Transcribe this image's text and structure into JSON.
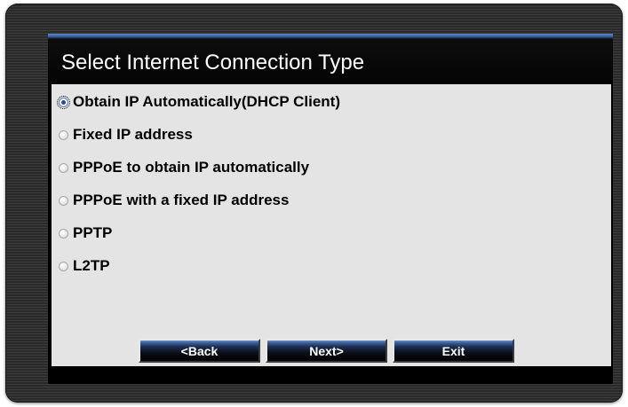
{
  "dialog": {
    "title": "Select Internet Connection Type"
  },
  "options": [
    {
      "label": "Obtain IP Automatically(DHCP Client)",
      "selected": true
    },
    {
      "label": "Fixed IP address",
      "selected": false
    },
    {
      "label": "PPPoE to obtain IP automatically",
      "selected": false
    },
    {
      "label": "PPPoE with a fixed IP address",
      "selected": false
    },
    {
      "label": "PPTP",
      "selected": false
    },
    {
      "label": "L2TP",
      "selected": false
    }
  ],
  "buttons": {
    "back_label": "<Back",
    "next_label": "Next>",
    "exit_label": "Exit"
  },
  "colors": {
    "frame": "#2f2f2f",
    "content_background": "#e4e4e4",
    "title_accent": "#4a72b4",
    "radio_selected": "#2b4f8c"
  }
}
